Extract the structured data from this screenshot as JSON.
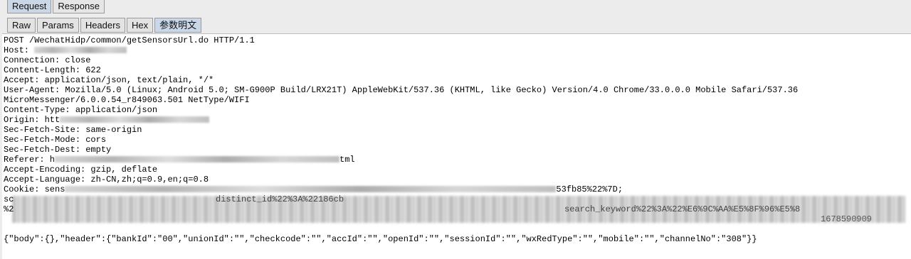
{
  "tabs": [
    "Request",
    "Response"
  ],
  "subtabs": [
    "Raw",
    "Params",
    "Headers",
    "Hex",
    "参数明文"
  ],
  "lines": [
    "POST /WechatHidp/common/getSensorsUrl.do HTTP/1.1",
    "Host: ",
    "Connection: close",
    "Content-Length: 622",
    "Accept: application/json, text/plain, */*",
    "User-Agent: Mozilla/5.0 (Linux; Android 5.0; SM-G900P Build/LRX21T) AppleWebKit/537.36 (KHTML, like Gecko) Version/4.0 Chrome/33.0.0.0 Mobile Safari/537.36",
    "MicroMessenger/6.0.0.54_r849063.501 NetType/WIFI",
    "Content-Type: application/json",
    "Origin: htt",
    "Sec-Fetch-Site: same-origin",
    "Sec-Fetch-Mode: cors",
    "Sec-Fetch-Dest: empty",
    "Referer: h",
    "Accept-Encoding: gzip, deflate",
    "Accept-Language: zh-CN,zh;q=0.9,en;q=0.8",
    "Cookie: sens"
  ],
  "fragments": {
    "referer_tail": "tml",
    "cookie_tail": "53fb85%22%7D;",
    "cookie_mid": "distinct_id%22%3A%22186cb",
    "search_frag": "search_keyword%22%3A%22%E6%9C%AA%E5%8F%96%E5%8",
    "num_tail": "1678590909",
    "sc_prefix": "sc",
    "pct_prefix": "%2"
  },
  "body_line": "{\"body\":{},\"header\":{\"bankId\":\"00\",\"unionId\":\"\",\"checkcode\":\"\",\"accId\":\"\",\"openId\":\"\",\"sessionId\":\"\",\"wxRedType\":\"\",\"mobile\":\"\",\"channelNo\":\"308\"}}"
}
